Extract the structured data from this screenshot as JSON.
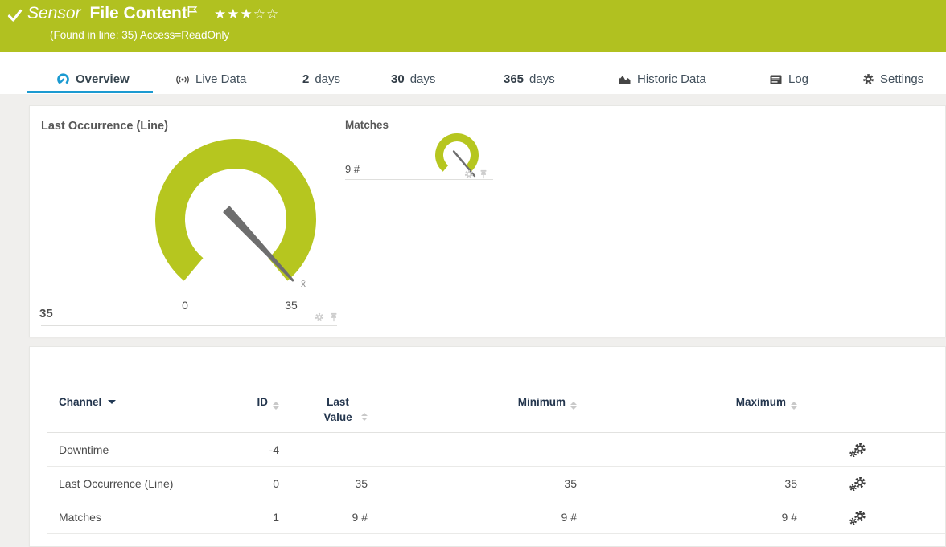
{
  "header": {
    "type_label": "Sensor",
    "name": "File Content",
    "rating_filled": "★★★",
    "rating_empty": "☆☆",
    "status_line": "(Found in line: 35) Access=ReadOnly"
  },
  "tabs": {
    "overview": "Overview",
    "live_data": "Live Data",
    "d2_num": "2",
    "d2_label": "days",
    "d30_num": "30",
    "d30_label": "days",
    "d365_num": "365",
    "d365_label": "days",
    "historic": "Historic Data",
    "log": "Log",
    "settings": "Settings"
  },
  "gauges": {
    "primary": {
      "title": "Last Occurrence (Line)",
      "value": "35",
      "scale_min": "0",
      "scale_max": "35",
      "avg_marker": "x̄"
    },
    "secondary": {
      "title": "Matches",
      "value": "9 #"
    }
  },
  "table": {
    "headers": {
      "channel": "Channel",
      "id": "ID",
      "last_value": "Last Value",
      "minimum": "Minimum",
      "maximum": "Maximum"
    },
    "rows": [
      {
        "channel": "Downtime",
        "id": "-4",
        "last_value": "",
        "minimum": "",
        "maximum": ""
      },
      {
        "channel": "Last Occurrence (Line)",
        "id": "0",
        "last_value": "35",
        "minimum": "35",
        "maximum": "35"
      },
      {
        "channel": "Matches",
        "id": "1",
        "last_value": "9 #",
        "minimum": "9 #",
        "maximum": "9 #"
      }
    ]
  },
  "colors": {
    "brand_green": "#b1c120",
    "gauge_green": "#b6c61f",
    "accent_blue": "#1b9ad1"
  }
}
